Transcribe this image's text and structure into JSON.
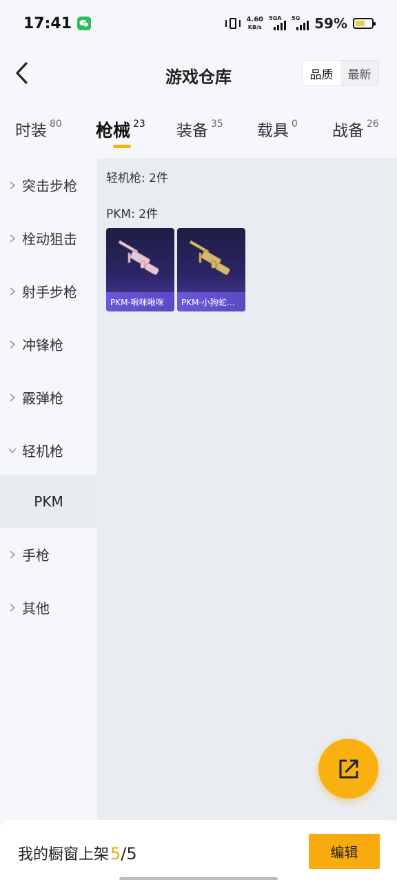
{
  "status_bar": {
    "time": "17:41",
    "net_speed_value": "4.60",
    "net_speed_unit": "KB/s",
    "sim1_label": "5GA",
    "sim2_label": "5G",
    "battery_percent": "59%",
    "battery_level": 0.59
  },
  "header": {
    "title": "游戏仓库",
    "sort_options": [
      "品质",
      "最新"
    ]
  },
  "category_tabs": [
    {
      "label": "时装",
      "count": "80"
    },
    {
      "label": "枪械",
      "count": "23",
      "active": true
    },
    {
      "label": "装备",
      "count": "35"
    },
    {
      "label": "载具",
      "count": "0"
    },
    {
      "label": "战备",
      "count": "26"
    }
  ],
  "sidebar": {
    "items": [
      "突击步枪",
      "栓动狙击",
      "射手步枪",
      "冲锋枪",
      "霰弹枪",
      "轻机枪",
      "手枪",
      "其他"
    ],
    "expanded_item": "轻机枪",
    "sub_item": "PKM"
  },
  "content": {
    "group_label": "轻机枪: 2件",
    "sub_label": "PKM: 2件",
    "skins": [
      {
        "name": "PKM-啾咪啾咪",
        "color": "#e8c6d4"
      },
      {
        "name": "PKM-小狗蛇…",
        "color": "#d8b86a"
      }
    ]
  },
  "footer": {
    "showcase_label": "我的橱窗上架",
    "showcase_current": "5",
    "showcase_total": "/5",
    "edit_label": "编辑"
  },
  "icons": {
    "back": "back-arrow-icon",
    "share": "share-external-icon",
    "chevron_right": "chevron-right-icon",
    "chevron_down": "chevron-down-icon"
  },
  "colors": {
    "accent": "#f8b10f",
    "card_background": "#2b2566",
    "panel_background": "#e9ecf0"
  }
}
